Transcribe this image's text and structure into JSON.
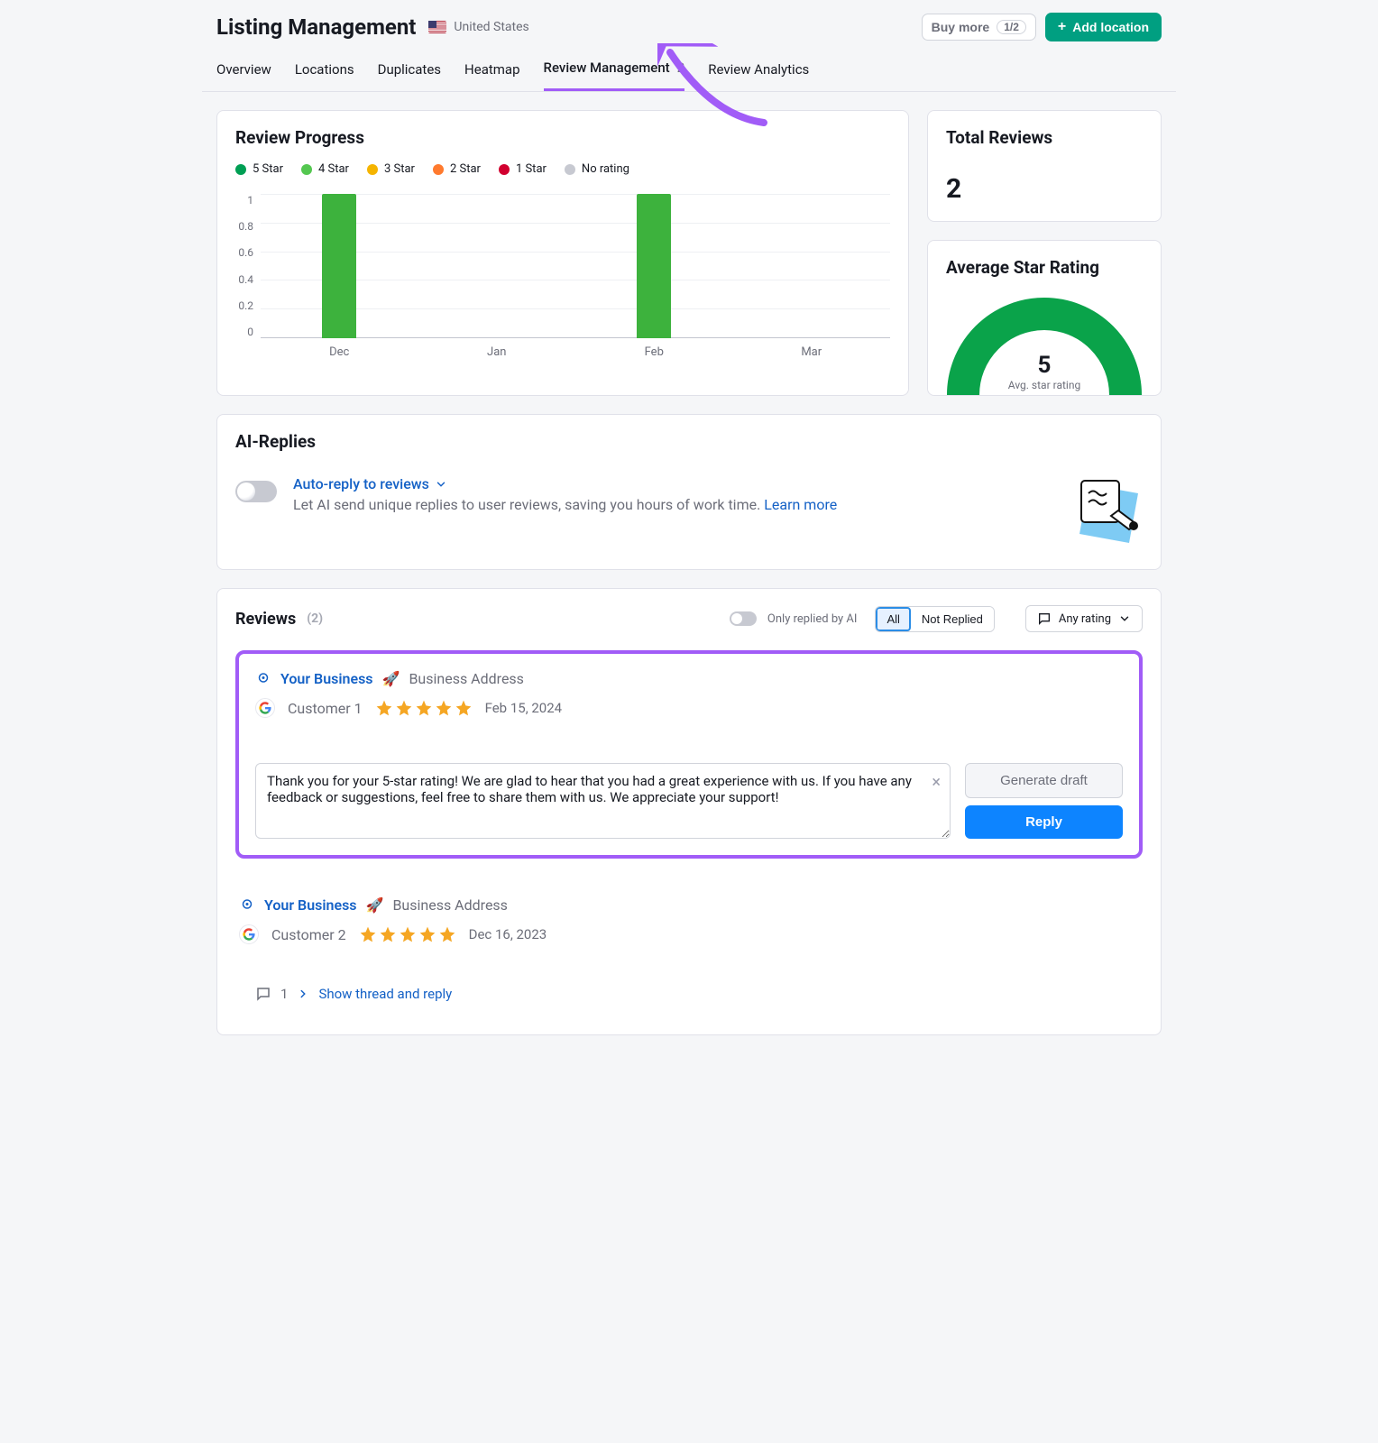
{
  "header": {
    "title": "Listing Management",
    "country": "United States",
    "buy_more": "Buy more",
    "buy_more_count": "1/2",
    "add_location": "Add location"
  },
  "tabs": [
    {
      "label": "Overview"
    },
    {
      "label": "Locations"
    },
    {
      "label": "Duplicates"
    },
    {
      "label": "Heatmap"
    },
    {
      "label": "Review Management",
      "badge": "2",
      "active": true
    },
    {
      "label": "Review Analytics"
    }
  ],
  "review_progress": {
    "title": "Review Progress",
    "legend": [
      {
        "label": "5 Star",
        "color": "#009f54"
      },
      {
        "label": "4 Star",
        "color": "#54c750"
      },
      {
        "label": "3 Star",
        "color": "#f5b400"
      },
      {
        "label": "2 Star",
        "color": "#ff7a2e"
      },
      {
        "label": "1 Star",
        "color": "#d1002f"
      },
      {
        "label": "No rating",
        "color": "#c7c9d1"
      }
    ]
  },
  "chart_data": {
    "type": "bar",
    "categories": [
      "Dec",
      "Jan",
      "Feb",
      "Mar"
    ],
    "series": [
      {
        "name": "5 Star",
        "color": "#3db23d",
        "values": [
          1,
          0,
          1,
          0
        ]
      }
    ],
    "yticks": [
      "1",
      "0.8",
      "0.6",
      "0.4",
      "0.2",
      "0"
    ],
    "ylim": [
      0,
      1
    ]
  },
  "total_reviews": {
    "title": "Total Reviews",
    "value": "2"
  },
  "avg_rating": {
    "title": "Average Star Rating",
    "value": "5",
    "subtitle": "Avg. star rating"
  },
  "ai": {
    "title": "AI-Replies",
    "link": "Auto-reply to reviews",
    "desc": "Let AI send unique replies to user reviews, saving you hours of work time. ",
    "learn": "Learn more"
  },
  "reviews": {
    "title": "Reviews",
    "count": "(2)",
    "only_ai": "Only replied by AI",
    "seg_all": "All",
    "seg_not": "Not Replied",
    "any_rating": "Any rating"
  },
  "rev1": {
    "business": "Your Business",
    "address": "Business Address",
    "customer": "Customer 1",
    "date": "Feb 15, 2024",
    "draft_text": "Thank you for your 5-star rating! We are glad to hear that you had a great experience with us. If you have any feedback or suggestions, feel free to share them with us. We appreciate your support!",
    "gen": "Generate draft",
    "reply": "Reply"
  },
  "rev2": {
    "business": "Your Business",
    "address": "Business Address",
    "customer": "Customer 2",
    "date": "Dec 16, 2023",
    "thread_count": "1",
    "show_thread": "Show thread and reply"
  }
}
